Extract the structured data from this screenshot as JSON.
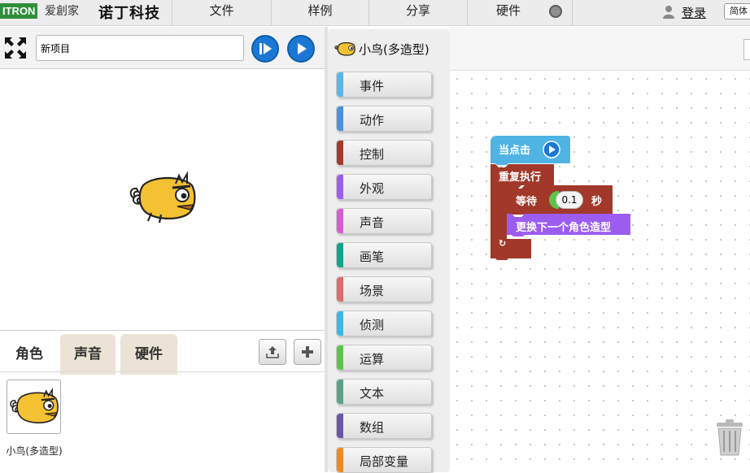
{
  "topbar": {
    "logo_text": "ITRON",
    "logo_cn": "爱創家",
    "brand": "诺丁科技",
    "menu": [
      "文件",
      "样例",
      "分享",
      "硬件"
    ],
    "login": "登录",
    "language": "简体"
  },
  "stage": {
    "project_name": "新项目"
  },
  "sprites_panel": {
    "tabs": [
      "角色",
      "声音",
      "硬件"
    ],
    "active_tab": "角色",
    "sprites": [
      {
        "name": "小鸟(多造型)"
      }
    ]
  },
  "palette": {
    "current_sprite": "小鸟(多造型)",
    "categories": [
      {
        "label": "事件",
        "color": "#5ab5e8"
      },
      {
        "label": "动作",
        "color": "#4a8fe0"
      },
      {
        "label": "控制",
        "color": "#a33a2b"
      },
      {
        "label": "外观",
        "color": "#9c5cf0"
      },
      {
        "label": "声音",
        "color": "#d35cd3"
      },
      {
        "label": "画笔",
        "color": "#0ea58c"
      },
      {
        "label": "场景",
        "color": "#de6a6a"
      },
      {
        "label": "侦测",
        "color": "#3cb8e6"
      },
      {
        "label": "运算",
        "color": "#5cc44a"
      },
      {
        "label": "文本",
        "color": "#5aa285"
      },
      {
        "label": "数组",
        "color": "#6b55a8"
      },
      {
        "label": "局部变量",
        "color": "#f08a1f"
      }
    ]
  },
  "script": {
    "hat_label": "当点击",
    "repeat_label": "重复执行",
    "wait_label": "等待",
    "wait_value": "0.1",
    "wait_unit": "秒",
    "costume_label": "更换下一个角色造型",
    "loop_icon": "loop-arrow-icon"
  }
}
